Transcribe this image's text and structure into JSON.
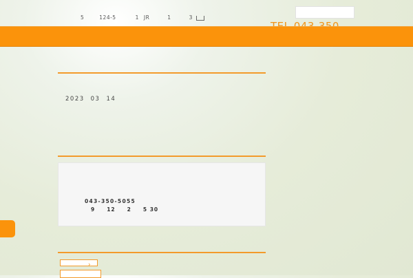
{
  "header": {
    "address_parts": [
      "5",
      "124-5",
      "1",
      "JR",
      "1",
      "3"
    ],
    "address_icon": "map-link-icon",
    "tel_text": "TEL 043-350"
  },
  "news": {
    "date_parts": [
      "2023",
      "03",
      "14"
    ]
  },
  "contact": {
    "phone": "043-350-5055",
    "hours_parts": [
      "9",
      "12",
      "2",
      "5",
      "30"
    ]
  },
  "footer": {
    "chevron": "›"
  },
  "colors": {
    "accent": "#fb930b",
    "rule": "#f39a2a",
    "tel": "#f0941a"
  }
}
